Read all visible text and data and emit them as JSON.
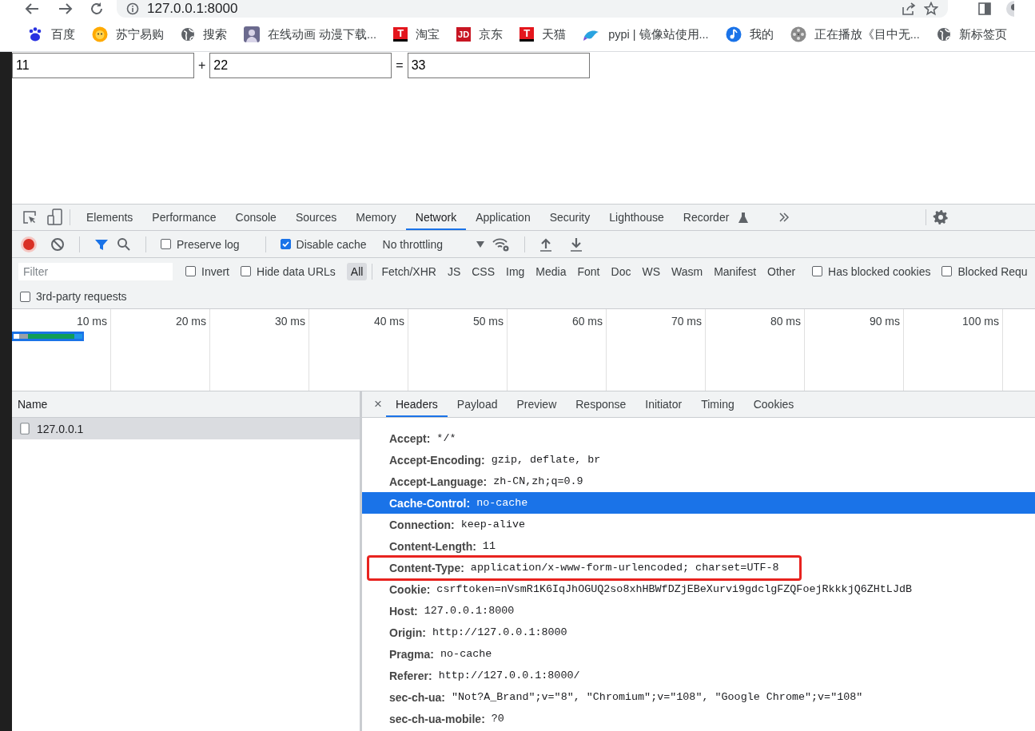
{
  "browser": {
    "address": "127.0.0.1:8000"
  },
  "bookmarks": [
    {
      "label": "百度",
      "kind": "paw"
    },
    {
      "label": "苏宁易购",
      "kind": "lion"
    },
    {
      "label": "搜索",
      "kind": "globe"
    },
    {
      "label": "在线动画 动漫下载...",
      "kind": "avatar"
    },
    {
      "label": "淘宝",
      "kind": "letter",
      "logo_text": "T"
    },
    {
      "label": "京东",
      "kind": "letter",
      "logo_text": "JD"
    },
    {
      "label": "天猫",
      "kind": "letter",
      "logo_text": "T"
    },
    {
      "label": "pypi | 镜像站使用...",
      "kind": "fish"
    },
    {
      "label": "我的",
      "kind": "note"
    },
    {
      "label": "正在播放《目中无...",
      "kind": "reel"
    },
    {
      "label": "新标签页",
      "kind": "globe"
    }
  ],
  "page": {
    "fields": [
      "11",
      "22",
      "33"
    ],
    "operators": [
      "+",
      "="
    ]
  },
  "devtools": {
    "panel_tabs": [
      {
        "label": "Elements",
        "selected": false
      },
      {
        "label": "Performance",
        "selected": false
      },
      {
        "label": "Console",
        "selected": false
      },
      {
        "label": "Sources",
        "selected": false
      },
      {
        "label": "Memory",
        "selected": false
      },
      {
        "label": "Network",
        "selected": true
      },
      {
        "label": "Application",
        "selected": false
      },
      {
        "label": "Security",
        "selected": false
      },
      {
        "label": "Lighthouse",
        "selected": false
      },
      {
        "label": "Recorder",
        "selected": false
      }
    ],
    "network_toolbar": {
      "recording": true,
      "filter_bar_open": true,
      "preserve_log": {
        "label": "Preserve log",
        "checked": false
      },
      "disable_cache": {
        "label": "Disable cache",
        "checked": true
      },
      "throttling": "No throttling"
    },
    "filter": {
      "placeholder": "Filter"
    },
    "filter_options": [
      {
        "label": "Invert",
        "checked": false
      },
      {
        "label": "Hide data URLs",
        "checked": false
      }
    ],
    "type_filters": [
      {
        "label": "All",
        "selected": true
      },
      {
        "label": "Fetch/XHR",
        "selected": false
      },
      {
        "label": "JS",
        "selected": false
      },
      {
        "label": "CSS",
        "selected": false
      },
      {
        "label": "Img",
        "selected": false
      },
      {
        "label": "Media",
        "selected": false
      },
      {
        "label": "Font",
        "selected": false
      },
      {
        "label": "Doc",
        "selected": false
      },
      {
        "label": "WS",
        "selected": false
      },
      {
        "label": "Wasm",
        "selected": false
      },
      {
        "label": "Manifest",
        "selected": false
      },
      {
        "label": "Other",
        "selected": false
      }
    ],
    "extra_options": [
      {
        "label": "Has blocked cookies",
        "checked": false
      },
      {
        "label": "Blocked Requ",
        "checked": false
      }
    ],
    "third_party": {
      "label": "3rd-party requests",
      "checked": false
    },
    "timeline": {
      "ticks": [
        "10 ms",
        "20 ms",
        "30 ms",
        "40 ms",
        "50 ms",
        "60 ms",
        "70 ms",
        "80 ms",
        "90 ms",
        "100 ms"
      ]
    },
    "requests": {
      "column": "Name",
      "rows": [
        {
          "name": "127.0.0.1",
          "selected": true
        }
      ]
    },
    "detail_close": "×",
    "detail_tabs": [
      {
        "label": "Headers",
        "selected": true
      },
      {
        "label": "Payload",
        "selected": false
      },
      {
        "label": "Preview",
        "selected": false
      },
      {
        "label": "Response",
        "selected": false
      },
      {
        "label": "Initiator",
        "selected": false
      },
      {
        "label": "Timing",
        "selected": false
      },
      {
        "label": "Cookies",
        "selected": false
      }
    ],
    "headers": [
      {
        "name": "Accept:",
        "value": "*/*",
        "selected": false,
        "annotated": false
      },
      {
        "name": "Accept-Encoding:",
        "value": "gzip, deflate, br",
        "selected": false,
        "annotated": false
      },
      {
        "name": "Accept-Language:",
        "value": "zh-CN,zh;q=0.9",
        "selected": false,
        "annotated": false
      },
      {
        "name": "Cache-Control:",
        "value": "no-cache",
        "selected": true,
        "annotated": false
      },
      {
        "name": "Connection:",
        "value": "keep-alive",
        "selected": false,
        "annotated": false
      },
      {
        "name": "Content-Length:",
        "value": "11",
        "selected": false,
        "annotated": false
      },
      {
        "name": "Content-Type:",
        "value": "application/x-www-form-urlencoded; charset=UTF-8",
        "selected": false,
        "annotated": true
      },
      {
        "name": "Cookie:",
        "value": "csrftoken=nVsmR1K6IqJhOGUQ2so8xhHBWfDZjEBeXurvi9gdclgFZQFoejRkkkjQ6ZHtLJdB",
        "selected": false,
        "annotated": false
      },
      {
        "name": "Host:",
        "value": "127.0.0.1:8000",
        "selected": false,
        "annotated": false
      },
      {
        "name": "Origin:",
        "value": "http://127.0.0.1:8000",
        "selected": false,
        "annotated": false
      },
      {
        "name": "Pragma:",
        "value": "no-cache",
        "selected": false,
        "annotated": false
      },
      {
        "name": "Referer:",
        "value": "http://127.0.0.1:8000/",
        "selected": false,
        "annotated": false
      },
      {
        "name": "sec-ch-ua:",
        "value": "\"Not?A_Brand\";v=\"8\", \"Chromium\";v=\"108\", \"Google Chrome\";v=\"108\"",
        "selected": false,
        "annotated": false
      },
      {
        "name": "sec-ch-ua-mobile:",
        "value": "?0",
        "selected": false,
        "annotated": false
      }
    ]
  }
}
